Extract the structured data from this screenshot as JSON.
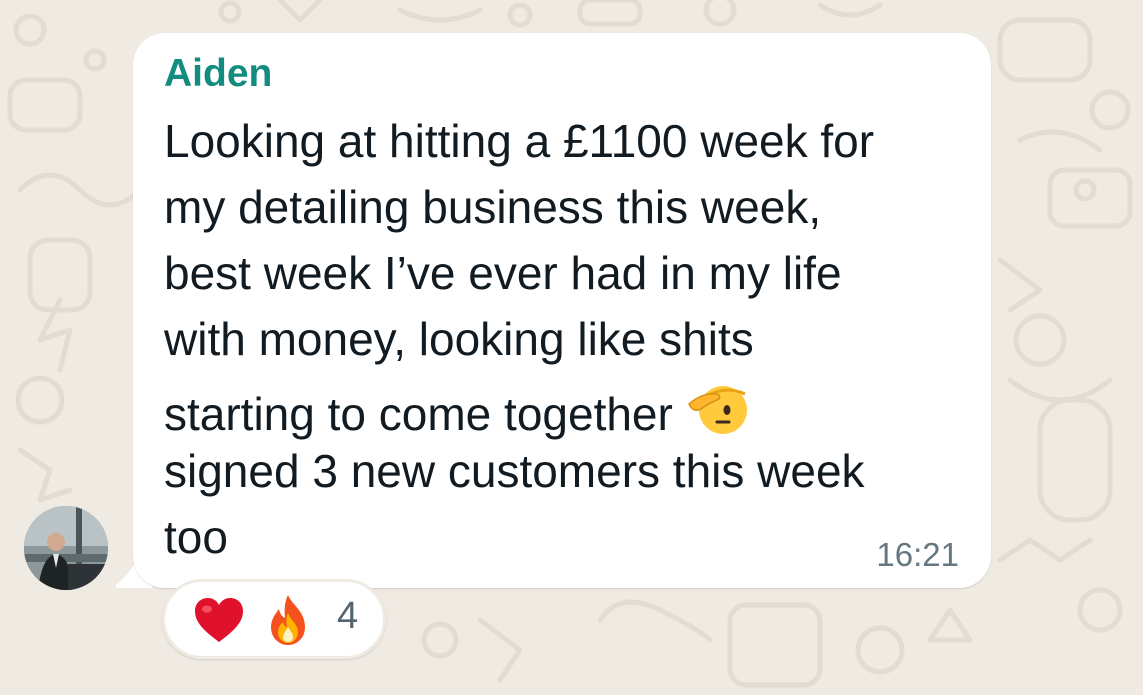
{
  "message": {
    "sender": "Aiden",
    "lines": [
      "Looking at hitting a £1100 week for",
      "my detailing business this week,",
      "best week I’ve ever had in my life",
      "with money, looking like shits",
      "starting to come together",
      "signed 3 new customers this week",
      "too"
    ],
    "inline_emoji": "saluting-face-emoji",
    "time": "16:21"
  },
  "reactions": {
    "emojis": [
      "red-heart-emoji",
      "fire-emoji"
    ],
    "count": "4"
  },
  "colors": {
    "background": "#efeae2",
    "bubble": "#ffffff",
    "sender_name": "#128c7e",
    "text": "#111b21",
    "timestamp": "#667781"
  }
}
